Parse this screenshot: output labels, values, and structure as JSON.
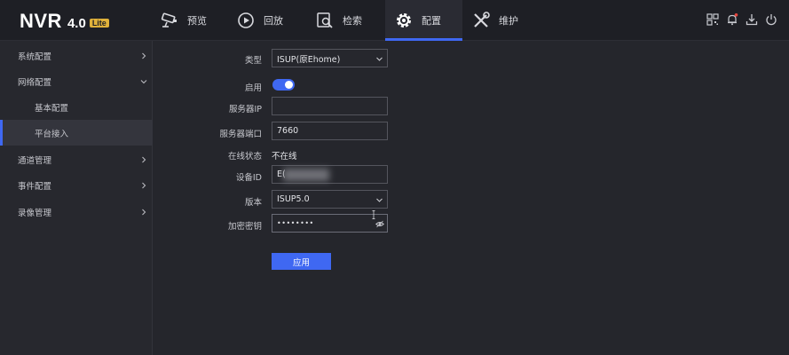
{
  "header": {
    "logo": {
      "name": "NVR",
      "version": "4.0",
      "badge": "Lite"
    },
    "nav": [
      {
        "label": "预览",
        "icon": "camera-icon"
      },
      {
        "label": "回放",
        "icon": "playback-icon"
      },
      {
        "label": "检索",
        "icon": "search-icon"
      },
      {
        "label": "配置",
        "icon": "gear-icon",
        "active": true
      },
      {
        "label": "维护",
        "icon": "wrench-icon"
      }
    ],
    "right_icons": [
      "qr-code-icon",
      "bell-icon",
      "download-icon",
      "power-icon"
    ]
  },
  "sidebar": {
    "items": [
      {
        "label": "系统配置",
        "expanded": false
      },
      {
        "label": "网络配置",
        "expanded": true
      },
      {
        "label": "基本配置"
      },
      {
        "label": "平台接入",
        "selected": true
      },
      {
        "label": "通道管理",
        "expanded": false
      },
      {
        "label": "事件配置",
        "expanded": false
      },
      {
        "label": "录像管理",
        "expanded": false
      }
    ]
  },
  "form": {
    "type": {
      "label": "类型",
      "value": "ISUP(原Ehome)"
    },
    "enable": {
      "label": "启用",
      "on": true
    },
    "server_ip": {
      "label": "服务器IP",
      "value": ""
    },
    "server_port": {
      "label": "服务器端口",
      "value": "7660"
    },
    "online_status": {
      "label": "在线状态",
      "value": "不在线"
    },
    "device_id": {
      "label": "设备ID",
      "value": "E("
    },
    "version": {
      "label": "版本",
      "value": "ISUP5.0"
    },
    "encryption_key": {
      "label": "加密密钥",
      "value": "••••••••"
    },
    "apply_label": "应用"
  },
  "colors": {
    "accent": "#3f68f2",
    "notification_dot": "#e8473f"
  }
}
